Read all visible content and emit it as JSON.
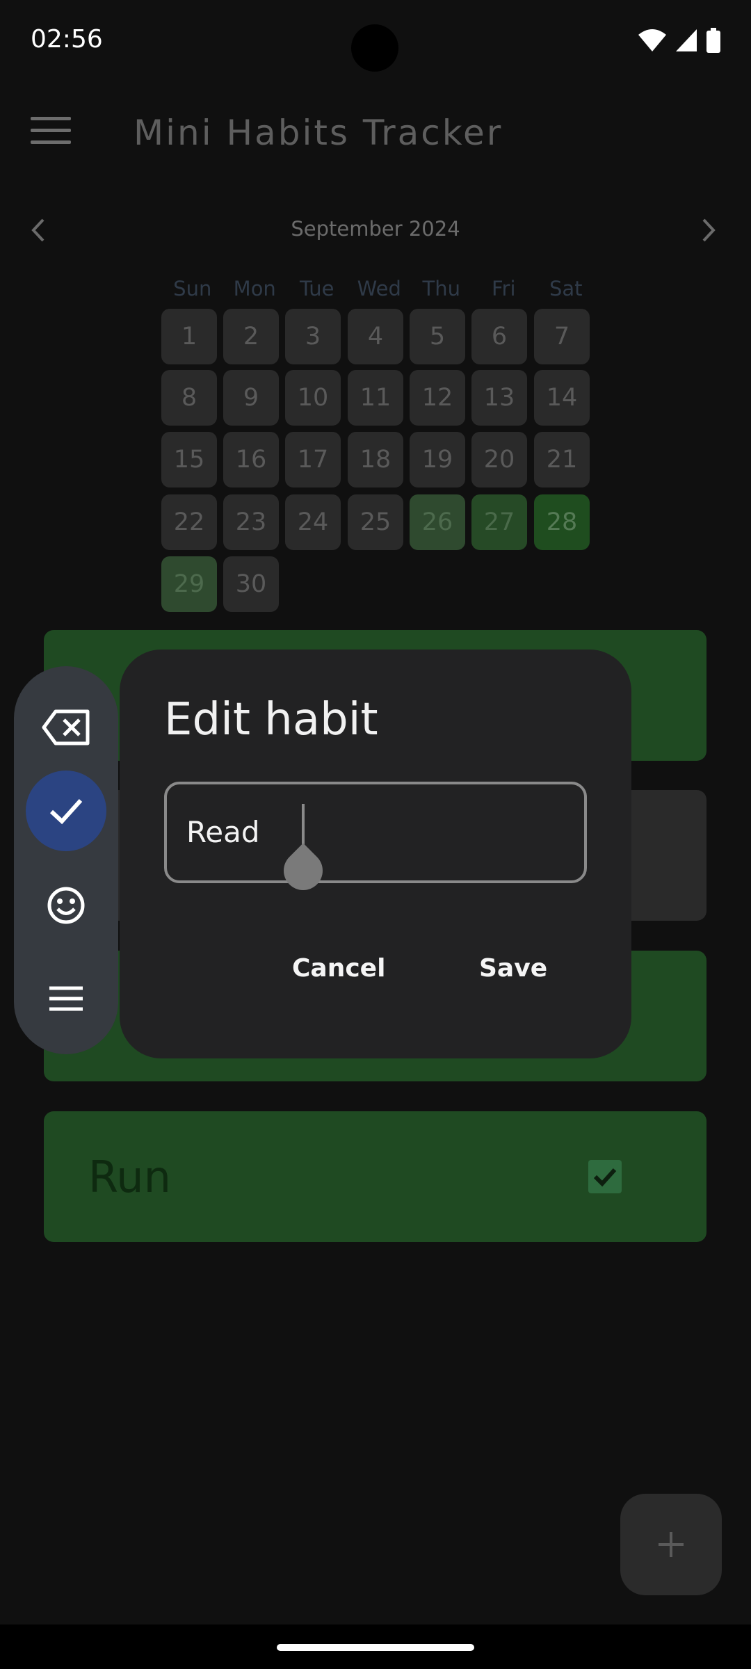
{
  "status_bar": {
    "time": "02:56"
  },
  "app_bar": {
    "title": "Mini Habits Tracker"
  },
  "calendar": {
    "month_label": "September 2024",
    "weekdays": [
      "Sun",
      "Mon",
      "Tue",
      "Wed",
      "Thu",
      "Fri",
      "Sat"
    ],
    "days": [
      "1",
      "2",
      "3",
      "4",
      "5",
      "6",
      "7",
      "8",
      "9",
      "10",
      "11",
      "12",
      "13",
      "14",
      "15",
      "16",
      "17",
      "18",
      "19",
      "20",
      "21",
      "22",
      "23",
      "24",
      "25",
      "26",
      "27",
      "28",
      "29",
      "30"
    ]
  },
  "habits": [
    {
      "name": "Run",
      "checked": true
    }
  ],
  "dialog": {
    "title": "Edit habit",
    "input_value": "Read",
    "cancel_label": "Cancel",
    "save_label": "Save"
  },
  "keyboard_toolbar": {
    "icons": [
      "backspace-icon",
      "check-icon",
      "emoji-icon",
      "menu-icon"
    ]
  },
  "colors": {
    "background": "#101010",
    "dialog": "#222223",
    "habit_done": "#1f4a22",
    "accent": "#2b4482"
  }
}
